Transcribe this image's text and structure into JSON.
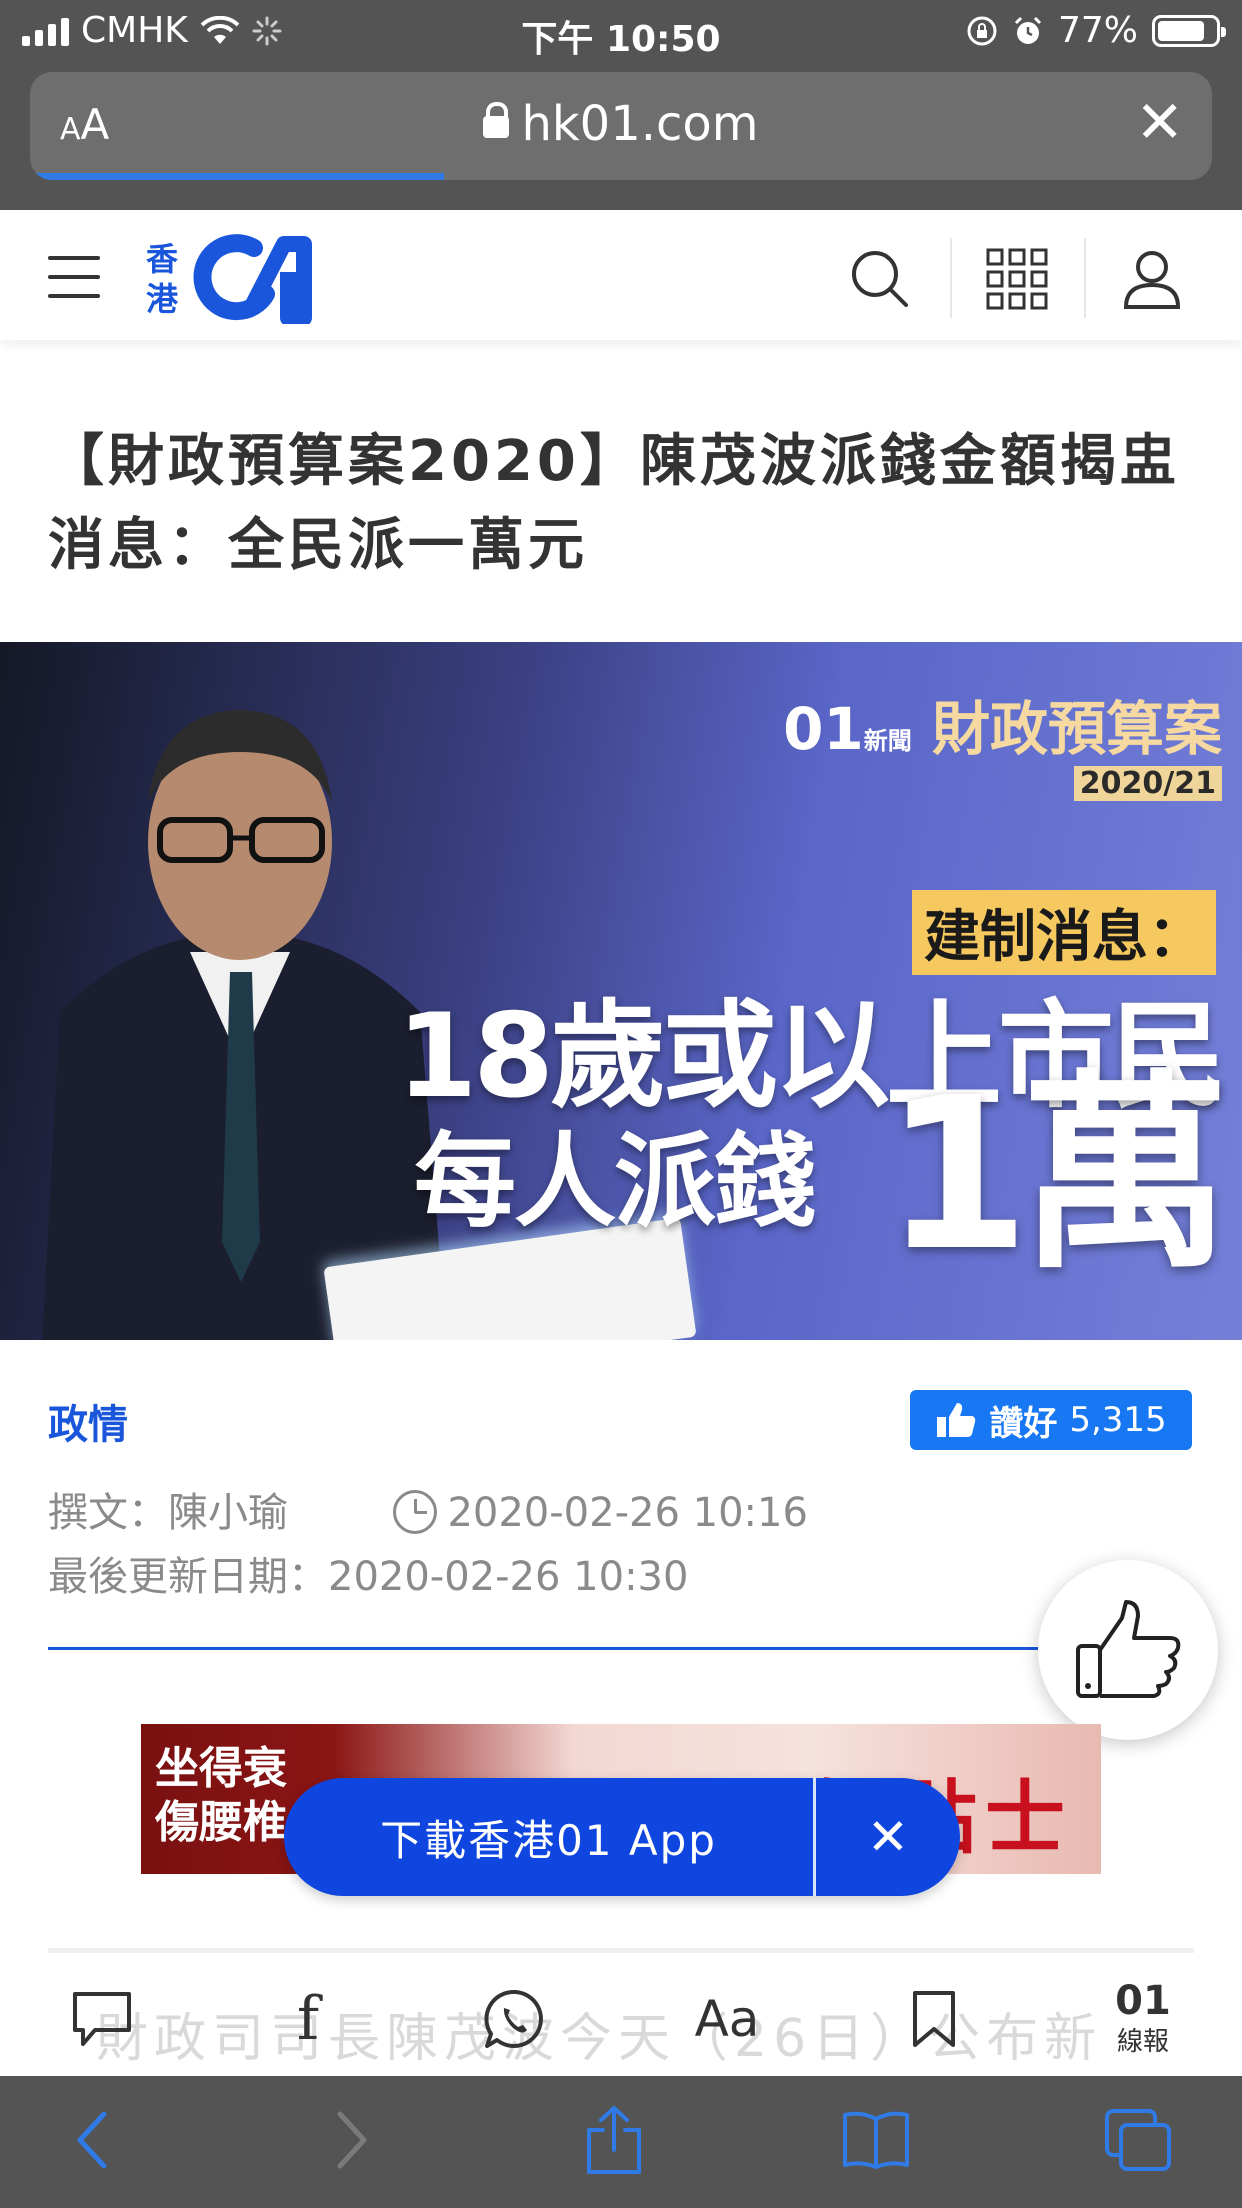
{
  "status_bar": {
    "carrier": "CMHK",
    "time": "下午 10:50",
    "battery": "77%"
  },
  "browser": {
    "text_size_small": "A",
    "text_size_large": "A",
    "url": "hk01.com",
    "load_progress": 0.35
  },
  "site": {
    "logo_cn_top": "香",
    "logo_cn_bottom": "港",
    "brand_color": "#1a56db"
  },
  "article": {
    "headline": "【財政預算案2020】陳茂波派錢金額揭盅　消息：全民派一萬元",
    "hero": {
      "brand_tag": "財政預算案",
      "brand_o1": "01",
      "brand_news": "新聞",
      "brand_year": "2020/21",
      "tag": "建制消息：",
      "line1": "18歲或以上市民",
      "line2": "每人派錢",
      "big": "1萬"
    },
    "category": "政情",
    "like": {
      "label": "讚好",
      "count": "5,315"
    },
    "author": "撰文：陳小瑜",
    "published": "2020-02-26 10:16",
    "updated": "最後更新日期：2020-02-26 10:30",
    "body_first_line": "財政司司長陳茂波今天（26日）公布新"
  },
  "ad": {
    "text_line1": "坐得衰",
    "text_line2": "傷腰椎",
    "title": "醫師貼士"
  },
  "app_banner": {
    "label": "下載香港01 App",
    "close": "✕"
  },
  "article_toolbar": {
    "font_size": "Aa",
    "news_logo": "01",
    "news_label": "線報"
  }
}
